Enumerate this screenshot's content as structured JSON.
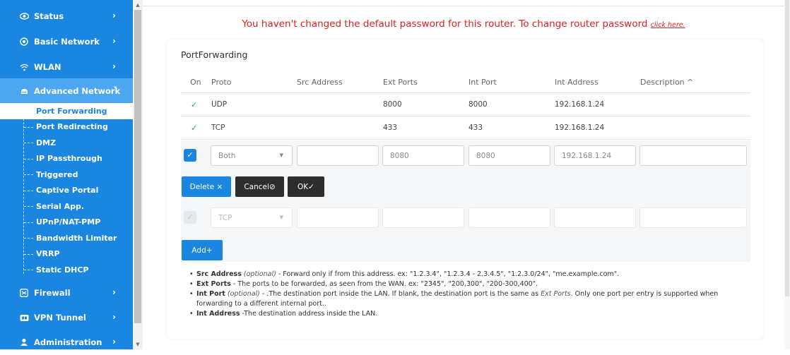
{
  "sidebar": {
    "items": [
      {
        "label": "Status",
        "icon": "eye-icon"
      },
      {
        "label": "Basic Network",
        "icon": "globe-icon"
      },
      {
        "label": "WLAN",
        "icon": "wifi-icon"
      },
      {
        "label": "Advanced Network",
        "icon": "cloud-icon"
      },
      {
        "label": "Firewall",
        "icon": "shield-icon"
      },
      {
        "label": "VPN Tunnel",
        "icon": "tunnel-icon"
      },
      {
        "label": "Administration",
        "icon": "user-admin-icon"
      }
    ],
    "chevron_right": "›",
    "chevron_down": "˅",
    "subitems": [
      "Port Forwarding",
      "Port Redirecting",
      "DMZ",
      "IP Passthrough",
      "Triggered",
      "Captive Portal",
      "Serial App.",
      "UPnP/NAT-PMP",
      "Bandwidth Limiter",
      "VRRP",
      "Static DHCP"
    ],
    "accent": "#1a86e0"
  },
  "banner": {
    "message": "You haven't changed the default password for this router. To change router password",
    "link": "click here.",
    "color": "#e02020"
  },
  "panel": {
    "title": "PortForwarding",
    "columns": [
      "On",
      "Proto",
      "Src Address",
      "Ext Ports",
      "Int Port",
      "Int Address",
      "Description ^"
    ],
    "rows": [
      {
        "on": "✓",
        "proto": "UDP",
        "src": "",
        "ext": "8000",
        "int_port": "8000",
        "int_addr": "192.168.1.24",
        "desc": ""
      },
      {
        "on": "✓",
        "proto": "TCP",
        "src": "",
        "ext": "433",
        "int_port": "433",
        "int_addr": "192.168.1.24",
        "desc": ""
      }
    ],
    "edit_row": {
      "proto": "Both",
      "src": "",
      "ext": "8080",
      "int_port": "8080",
      "int_addr": "192.168.1.24",
      "desc": ""
    },
    "new_row": {
      "proto": "TCP"
    },
    "buttons": {
      "delete": "Delete ×",
      "cancel": "Cancel⊘",
      "ok": "OK✓",
      "add": "Add+"
    },
    "check_glyph": "✓",
    "select_arrow": "▼"
  },
  "help": [
    {
      "term": "Src Address",
      "qualifier": "(optional)",
      "text": " - Forward only if from this address. ex: \"1.2.3.4\", \"1.2.3.4 - 2.3.4.5\", \"1.2.3.0/24\", \"me.example.com\"."
    },
    {
      "term": "Ext Ports",
      "qualifier": "",
      "text": " - The ports to be forwarded, as seen from the WAN. ex: \"2345\", \"200,300\", \"200-300,400\"."
    },
    {
      "term": "Int Port",
      "qualifier": "(optional)",
      "text": " - .The destination port inside the LAN. If blank, the destination port is the same as ",
      "em": "Ext Ports",
      "text2": ". Only one port per entry is supported when forwarding to a different internal port.."
    },
    {
      "term": "Int Address",
      "qualifier": "",
      "text": " -The destination address inside the LAN."
    }
  ],
  "scroll": {
    "up": "▲",
    "down": "▼"
  }
}
